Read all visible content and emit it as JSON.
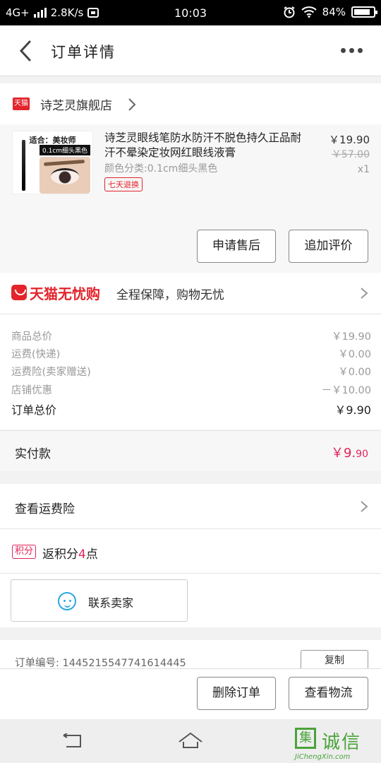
{
  "status_bar": {
    "network": "4G+",
    "speed": "2.8K/s",
    "time": "10:03",
    "battery": "84%",
    "battery_level": 0.84
  },
  "nav": {
    "title": "订单详情",
    "back_icon": "back-arrow-icon",
    "more_icon": "more-dots-icon"
  },
  "shop": {
    "logo_text": "天猫",
    "name": "诗芝灵旗舰店"
  },
  "product": {
    "image_label_top": "适合：美妆师",
    "image_label_tag": "0.1cm细头黑色",
    "title": "诗芝灵眼线笔防水防汗不脱色持久正品耐汗不晕染定妆网红眼线液膏",
    "spec": "颜色分类:0.1cm细头黑色",
    "badge": "七天退换",
    "price": "￥19.90",
    "original_price": "￥57.00",
    "quantity": "x1"
  },
  "actions": {
    "after_sale": "申请售后",
    "add_review": "追加评价",
    "delete_order": "删除订单",
    "view_logistics": "查看物流",
    "copy": "复制"
  },
  "guarantee": {
    "brand": "天猫无忧购",
    "text": "全程保障，购物无忧"
  },
  "totals": [
    {
      "label": "商品总价",
      "value": "￥19.90"
    },
    {
      "label": "运费(快递)",
      "value": "￥0.00"
    },
    {
      "label": "运费险(卖家赠送)",
      "value": "￥0.00"
    },
    {
      "label": "店铺优惠",
      "value": "－￥10.00"
    },
    {
      "label": "订单总价",
      "value": "￥9.90"
    }
  ],
  "paid": {
    "label": "实付款",
    "value_main": "￥9.",
    "value_cents": "90"
  },
  "insurance": {
    "label": "查看运费险"
  },
  "points": {
    "tag": "积分",
    "prefix": "返积分",
    "count": "4",
    "suffix": "点"
  },
  "contact": {
    "label": "联系卖家"
  },
  "order": {
    "number_label": "订单编号:",
    "number": "1445215547741614445"
  },
  "watermark": {
    "icon_char": "集",
    "brand": "诚信",
    "url": "JiChengXin.com"
  },
  "colors": {
    "tmall_red": "#e3242b",
    "price_pink": "#e3245a",
    "contact_blue": "#2aa8e0",
    "watermark_green": "#4aa33a"
  }
}
